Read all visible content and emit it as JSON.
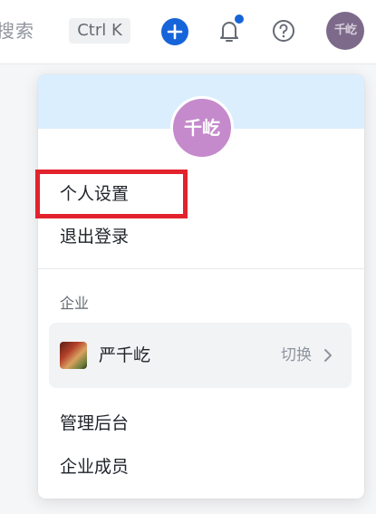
{
  "topbar": {
    "search_text": "搜索",
    "shortcut": "Ctrl K",
    "add_icon": "plus-icon",
    "notification_icon": "bell-icon",
    "help_icon": "question-circle-icon",
    "avatar_text": "千屹"
  },
  "menu": {
    "avatar_text": "千屹",
    "personal_settings": "个人设置",
    "logout": "退出登录",
    "section_label": "企业",
    "org": {
      "name": "严千屹",
      "switch_label": "切换"
    },
    "admin_console": "管理后台",
    "org_members": "企业成员"
  },
  "colors": {
    "accent": "#1664d9",
    "banner": "#dbeefe",
    "avatar": "#c58acc",
    "highlight": "#e2232d"
  }
}
